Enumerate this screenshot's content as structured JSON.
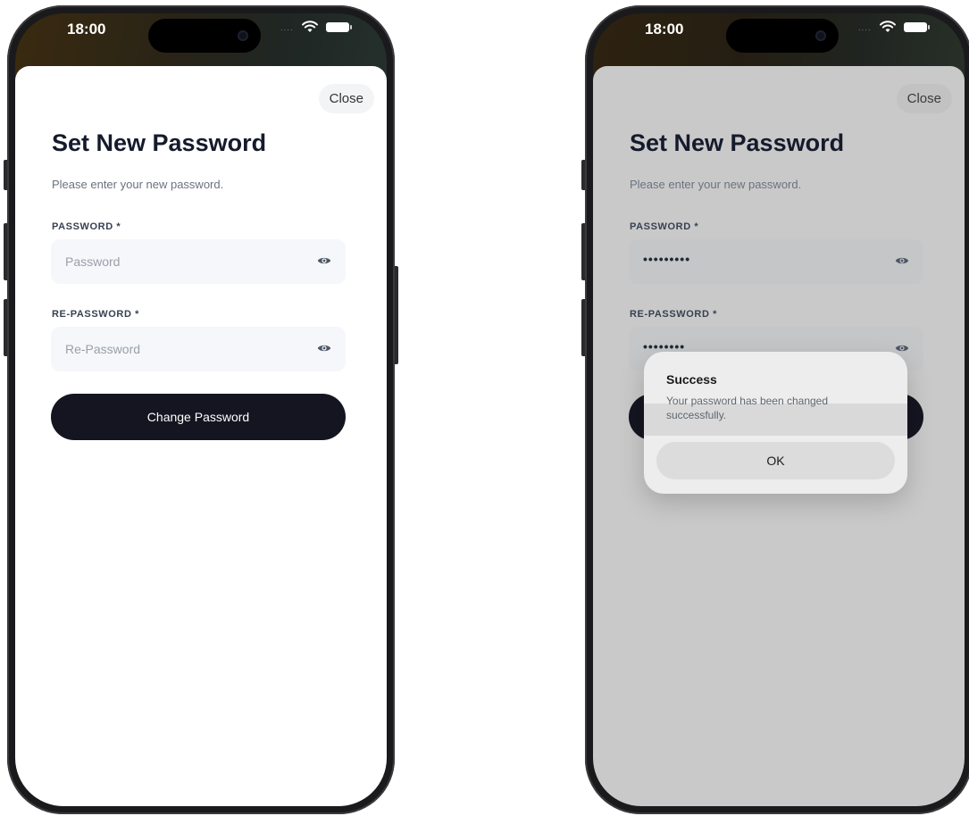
{
  "status_bar": {
    "time": "18:00"
  },
  "screen": {
    "close_label": "Close",
    "title": "Set New Password",
    "subtitle": "Please enter your new password.",
    "password_label": "PASSWORD *",
    "password_placeholder": "Password",
    "repassword_label": "RE-PASSWORD *",
    "repassword_placeholder": "Re-Password",
    "button_label": "Change Password"
  },
  "filled_screen": {
    "password_value": "•••••••••",
    "repassword_value": "••••••••"
  },
  "dialog": {
    "title": "Success",
    "message": "Your password has been changed successfully.",
    "ok_label": "OK"
  }
}
